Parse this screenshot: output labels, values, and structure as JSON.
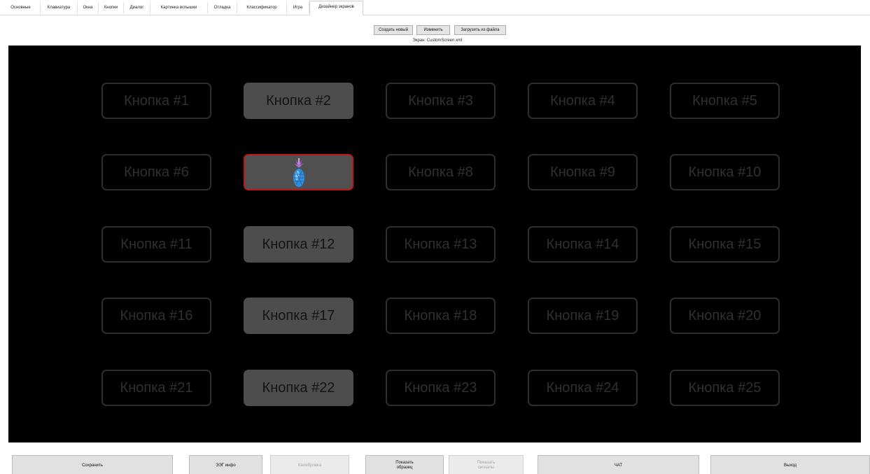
{
  "tabs": [
    {
      "label": "Основные",
      "active": false
    },
    {
      "label": "Клавиатура",
      "active": false
    },
    {
      "label": "Окна",
      "active": false
    },
    {
      "label": "Кнопки",
      "active": false
    },
    {
      "label": "Диалог",
      "active": false
    },
    {
      "label": "Картинка вспышки",
      "active": false
    },
    {
      "label": "Отладка",
      "active": false
    },
    {
      "label": "Классификатор",
      "active": false
    },
    {
      "label": "Игра",
      "active": false
    },
    {
      "label": "Дизайнер экранов",
      "active": true
    }
  ],
  "toolbar": {
    "create_label": "Создать новый",
    "edit_label": "Изменить",
    "load_label": "Загрузить из файла",
    "screen_label": "Экран: CustomScreen.xml"
  },
  "grid": {
    "colors": {
      "dim_border": "#2e2e2e",
      "dim_text": "#303030",
      "lit_fill": "#4d4d4d",
      "lit_text": "#141414",
      "selected_border": "#c01818"
    },
    "selected_icon": "pineapple-icon",
    "buttons": [
      {
        "label": "Кнопка #1",
        "state": "dim"
      },
      {
        "label": "Кнопка #2",
        "state": "lit"
      },
      {
        "label": "Кнопка #3",
        "state": "dim"
      },
      {
        "label": "Кнопка #4",
        "state": "dim"
      },
      {
        "label": "Кнопка #5",
        "state": "dim"
      },
      {
        "label": "Кнопка #6",
        "state": "dim"
      },
      {
        "label": "",
        "state": "selected"
      },
      {
        "label": "Кнопка #8",
        "state": "dim"
      },
      {
        "label": "Кнопка #9",
        "state": "dim"
      },
      {
        "label": "Кнопка #10",
        "state": "dim"
      },
      {
        "label": "Кнопка #11",
        "state": "dim"
      },
      {
        "label": "Кнопка #12",
        "state": "lit"
      },
      {
        "label": "Кнопка #13",
        "state": "dim"
      },
      {
        "label": "Кнопка #14",
        "state": "dim"
      },
      {
        "label": "Кнопка #15",
        "state": "dim"
      },
      {
        "label": "Кнопка #16",
        "state": "dim"
      },
      {
        "label": "Кнопка #17",
        "state": "lit"
      },
      {
        "label": "Кнопка #18",
        "state": "dim"
      },
      {
        "label": "Кнопка #19",
        "state": "dim"
      },
      {
        "label": "Кнопка #20",
        "state": "dim"
      },
      {
        "label": "Кнопка #21",
        "state": "dim"
      },
      {
        "label": "Кнопка #22",
        "state": "lit"
      },
      {
        "label": "Кнопка #23",
        "state": "dim"
      },
      {
        "label": "Кнопка #24",
        "state": "dim"
      },
      {
        "label": "Кнопка #25",
        "state": "dim"
      }
    ]
  },
  "bottom": {
    "save_label": "Сохранить",
    "eeg_label": "ЭЭГ инфо",
    "calibrate_label": "Калибровка",
    "show_sample_label": "Показать образец",
    "show_signals_label": "Показать сигналы",
    "chat_label": "ЧАТ",
    "exit_label": "Выход"
  }
}
